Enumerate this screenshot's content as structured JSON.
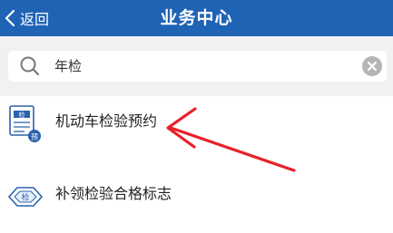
{
  "header": {
    "back_label": "返回",
    "title": "业务中心",
    "background_color": "#1f63b5"
  },
  "search": {
    "value": "年检",
    "icon": "search-icon",
    "clear_icon": "clear-icon"
  },
  "items": [
    {
      "label": "机动车检验预约",
      "icon": "inspection-appointment-icon",
      "icon_badge_top": "检",
      "icon_badge_corner": "预"
    },
    {
      "label": "补领检验合格标志",
      "icon": "inspection-sticker-icon",
      "icon_badge": "检"
    }
  ],
  "annotation": {
    "type": "red-arrow",
    "color": "#e8202a",
    "target": "机动车检验预约"
  }
}
